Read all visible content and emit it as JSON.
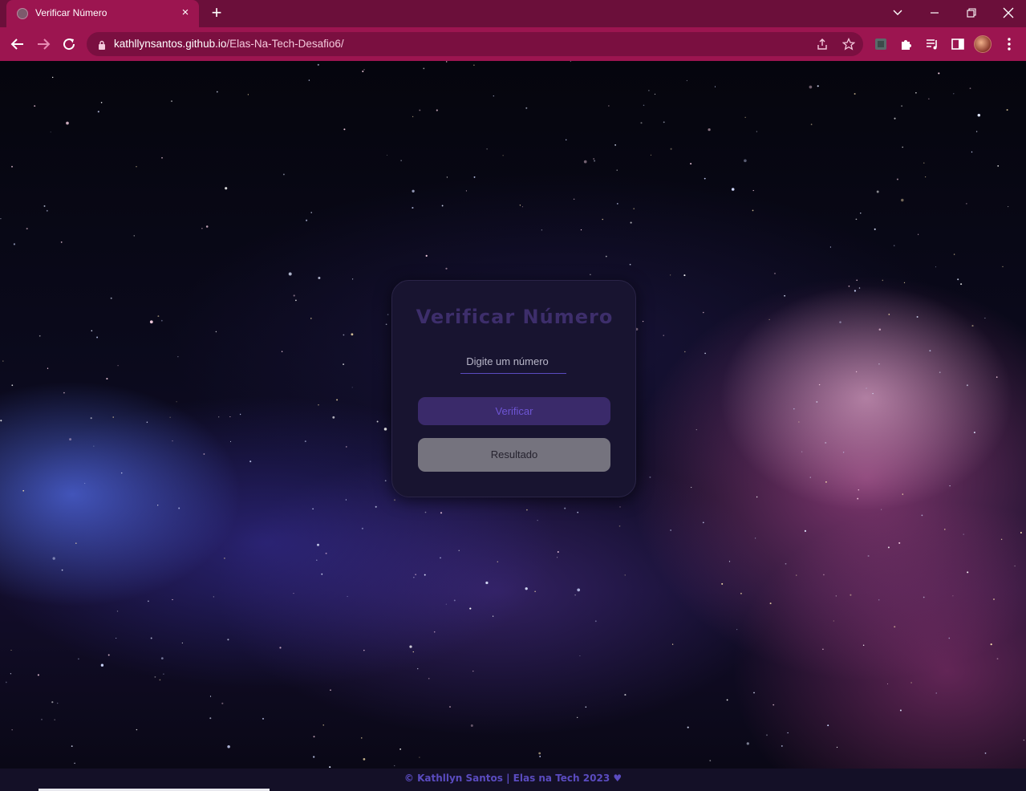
{
  "browser": {
    "tab_title": "Verificar Número",
    "tab_close": "×",
    "new_tab": "+",
    "url_host": "kathllynsantos.github.io",
    "url_path": "/Elas-Na-Tech-Desafio6/",
    "accent": "#9c1550",
    "tabbar_color": "#6b0f3a"
  },
  "card": {
    "title": "Verificar Número",
    "input_placeholder": "Digite um número",
    "verify_label": "Verificar",
    "result_label": "Resultado"
  },
  "footer": {
    "text": "© Kathllyn Santos | Elas na Tech 2023 ♥"
  }
}
